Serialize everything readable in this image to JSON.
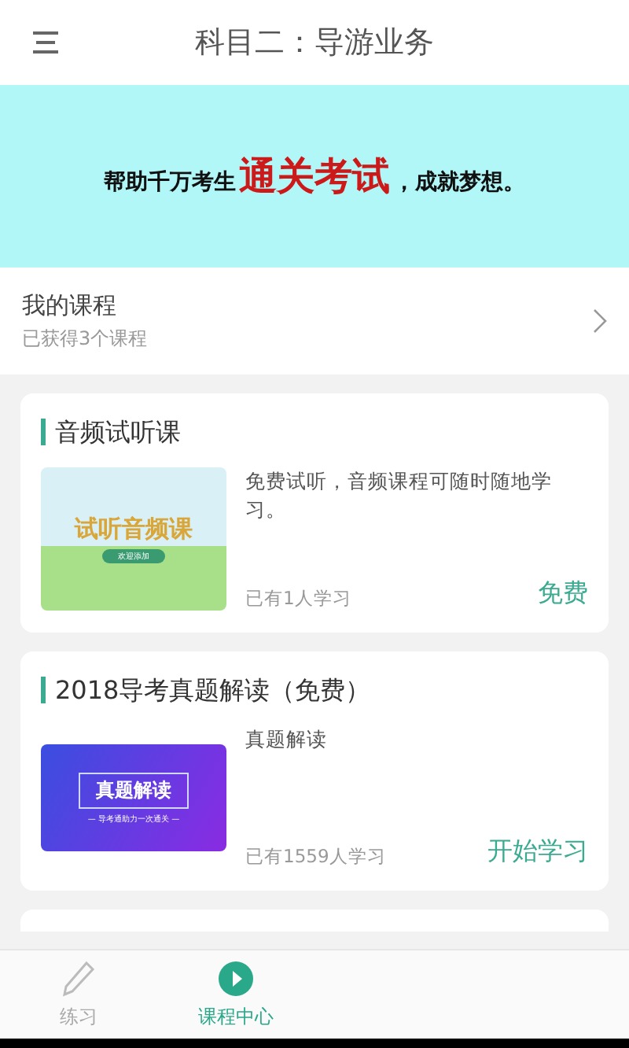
{
  "header": {
    "title": "科目二：导游业务"
  },
  "banner": {
    "lead": "帮助千万考生",
    "highlight": "通关考试",
    "tail": "，成就梦想。"
  },
  "my_courses": {
    "title": "我的课程",
    "subtitle": "已获得3个课程"
  },
  "courses": [
    {
      "kind": "audio",
      "title": "音频试听课",
      "thumb_title": "试听音频课",
      "thumb_tag": "欢迎添加",
      "description": "免费试听，音频课程可随时随地学习。",
      "learners": "已有1人学习",
      "action": "免费"
    },
    {
      "kind": "exam",
      "title": "2018导考真题解读（免费）",
      "thumb_title": "真题解读",
      "thumb_tag": "— 导考通助力一次通关 —",
      "description": "真题解读",
      "learners": "已有1559人学习",
      "action": "开始学习"
    }
  ],
  "tabs": [
    {
      "label": "练习",
      "kind": "practice",
      "selected": false
    },
    {
      "label": "课程中心",
      "kind": "courses",
      "selected": true
    }
  ]
}
